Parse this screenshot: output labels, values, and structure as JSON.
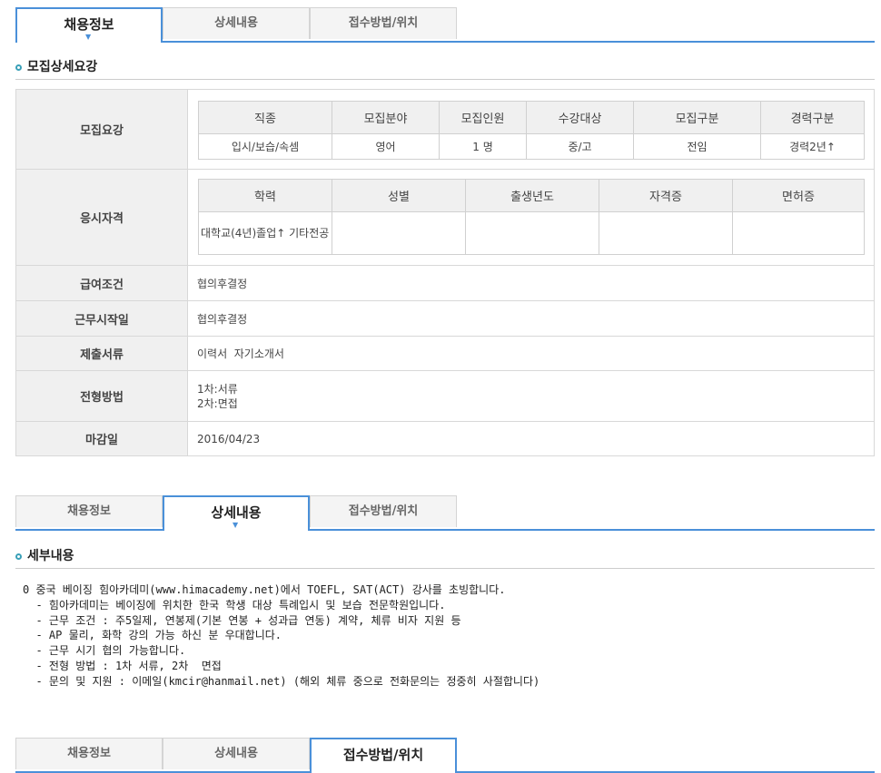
{
  "tabs": [
    "채용정보",
    "상세내용",
    "접수방법/위치"
  ],
  "section1": {
    "title": "모집상세요강",
    "rows": {
      "recruit_label": "모집요강",
      "qual_label": "응시자격",
      "salary_label": "급여조건",
      "salary_value": "협의후결정",
      "start_label": "근무시작일",
      "start_value": "협의후결정",
      "docs_label": "제출서류",
      "docs_value": "이력서  자기소개서",
      "process_label": "전형방법",
      "process_value_1": "1차:서류",
      "process_value_2": "2차:면접",
      "deadline_label": "마감일",
      "deadline_value": "2016/04/23"
    },
    "recruit_table": {
      "headers": [
        "직종",
        "모집분야",
        "모집인원",
        "수강대상",
        "모집구분",
        "경력구분"
      ],
      "values": [
        "입시/보습/속셈",
        "영어",
        "1 명",
        "중/고",
        "전임",
        "경력2년↑"
      ]
    },
    "qual_table": {
      "headers": [
        "학력",
        "성별",
        "출생년도",
        "자격증",
        "면허증"
      ],
      "values": [
        "대학교(4년)졸업↑ 기타전공",
        "",
        "",
        "",
        ""
      ]
    }
  },
  "section2": {
    "title": "세부내용",
    "lines": [
      "0 중국 베이징 힘아카데미(www.himacademy.net)에서 TOEFL, SAT(ACT) 강사를 초빙합니다.",
      "  - 힘아카데미는 베이징에 위치한 한국 학생 대상 특례입시 및 보습 전문학원입니다.",
      "  - 근무 조건 : 주5일제, 연봉제(기본 연봉 + 성과급 연동) 계약, 체류 비자 지원 등",
      "  - AP 물리, 화학 강의 가능 하신 분 우대합니다.",
      "  - 근무 시기 협의 가능합니다.",
      "  - 전형 방법 : 1차 서류, 2차  면접",
      "  - 문의 및 지원 : 이메일(kmcir@hanmail.net) (해외 체류 중으로 전화문의는 정중히 사절합니다)"
    ]
  }
}
